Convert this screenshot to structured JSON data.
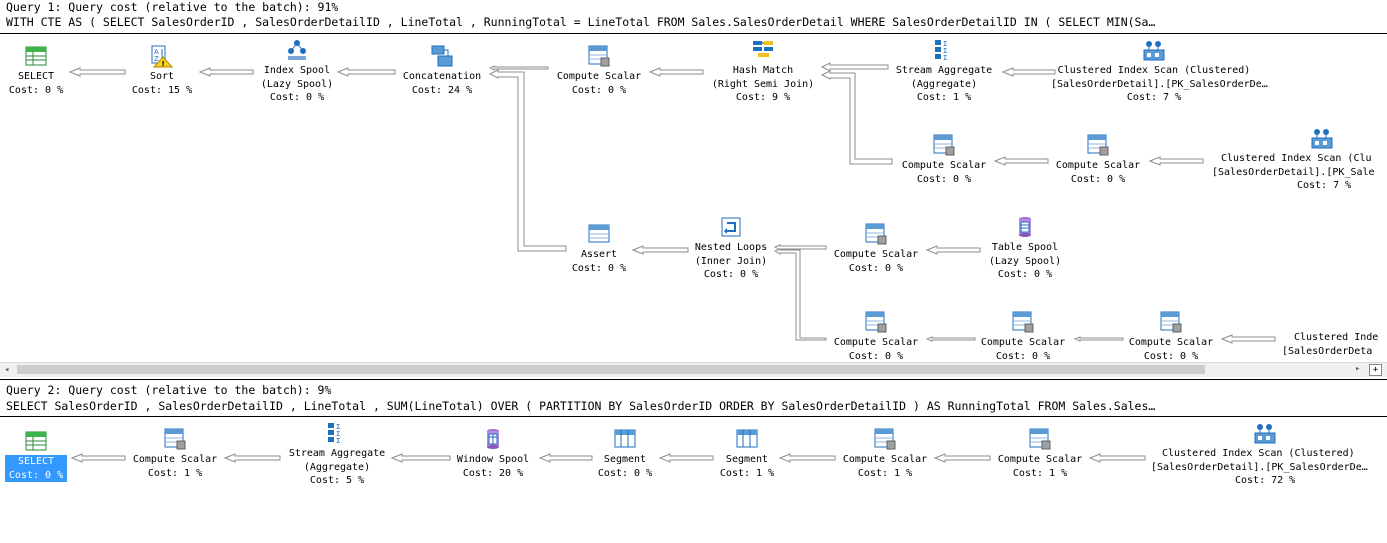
{
  "query1": {
    "header": "Query 1: Query cost (relative to the batch): 91%",
    "sql": "WITH CTE AS ( SELECT SalesOrderID , SalesOrderDetailID , LineTotal , RunningTotal = LineTotal FROM Sales.SalesOrderDetail WHERE SalesOrderDetailID IN ( SELECT MIN(Sa…",
    "nodes": {
      "select": {
        "icon": "select-icon",
        "l1": "SELECT",
        "l2": "Cost: 0 %"
      },
      "sort": {
        "icon": "sort-warning-icon",
        "l1": "Sort",
        "l2": "Cost: 15 %"
      },
      "index_spool": {
        "icon": "index-spool-icon",
        "l1": "Index Spool",
        "l2": "(Lazy Spool)",
        "l3": "Cost: 0 %"
      },
      "concatenation": {
        "icon": "concatenation-icon",
        "l1": "Concatenation",
        "l2": "Cost: 24 %"
      },
      "compute_scalar_a": {
        "icon": "compute-scalar-icon",
        "l1": "Compute Scalar",
        "l2": "Cost: 0 %"
      },
      "hash_match": {
        "icon": "hash-match-icon",
        "l1": "Hash Match",
        "l2": "(Right Semi Join)",
        "l3": "Cost: 9 %"
      },
      "stream_aggregate": {
        "icon": "stream-aggregate-icon",
        "l1": "Stream Aggregate",
        "l2": "(Aggregate)",
        "l3": "Cost: 1 %"
      },
      "ci_scan_a": {
        "icon": "clustered-index-scan-icon",
        "l1": "Clustered Index Scan (Clustered)",
        "l2": "[SalesOrderDetail].[PK_SalesOrderDe…",
        "l3": "Cost: 7 %"
      },
      "compute_scalar_b": {
        "icon": "compute-scalar-icon",
        "l1": "Compute Scalar",
        "l2": "Cost: 0 %"
      },
      "compute_scalar_c": {
        "icon": "compute-scalar-icon",
        "l1": "Compute Scalar",
        "l2": "Cost: 0 %"
      },
      "ci_scan_b": {
        "icon": "clustered-index-scan-icon",
        "l1": "Clustered Index Scan (Clu",
        "l2": "[SalesOrderDetail].[PK_Sale",
        "l3": "Cost: 7 %"
      },
      "assert": {
        "icon": "assert-icon",
        "l1": "Assert",
        "l2": "Cost: 0 %"
      },
      "nested_loops": {
        "icon": "nested-loops-icon",
        "l1": "Nested Loops",
        "l2": "(Inner Join)",
        "l3": "Cost: 0 %"
      },
      "compute_scalar_d": {
        "icon": "compute-scalar-icon",
        "l1": "Compute Scalar",
        "l2": "Cost: 0 %"
      },
      "table_spool": {
        "icon": "table-spool-icon",
        "l1": "Table Spool",
        "l2": "(Lazy Spool)",
        "l3": "Cost: 0 %"
      },
      "compute_scalar_e": {
        "icon": "compute-scalar-icon",
        "l1": "Compute Scalar",
        "l2": "Cost: 0 %"
      },
      "compute_scalar_f": {
        "icon": "compute-scalar-icon",
        "l1": "Compute Scalar",
        "l2": "Cost: 0 %"
      },
      "compute_scalar_g": {
        "icon": "compute-scalar-icon",
        "l1": "Compute Scalar",
        "l2": "Cost: 0 %"
      },
      "ci_scan_c": {
        "icon": "clustered-index-scan-icon",
        "l1": "Clustered Inde",
        "l2": "[SalesOrderDeta"
      }
    }
  },
  "query2": {
    "header": "Query 2: Query cost (relative to the batch): 9%",
    "sql": "SELECT SalesOrderID , SalesOrderDetailID , LineTotal , SUM(LineTotal) OVER ( PARTITION BY SalesOrderID ORDER BY SalesOrderDetailID ) AS RunningTotal FROM Sales.Sales…",
    "nodes": {
      "select": {
        "icon": "select-icon",
        "l1": "SELECT",
        "l2": "Cost: 0 %"
      },
      "compute_scalar_a": {
        "icon": "compute-scalar-icon",
        "l1": "Compute Scalar",
        "l2": "Cost: 1 %"
      },
      "stream_aggregate": {
        "icon": "stream-aggregate-icon",
        "l1": "Stream Aggregate",
        "l2": "(Aggregate)",
        "l3": "Cost: 5 %"
      },
      "window_spool": {
        "icon": "window-spool-icon",
        "l1": "Window Spool",
        "l2": "Cost: 20 %"
      },
      "segment_a": {
        "icon": "segment-icon",
        "l1": "Segment",
        "l2": "Cost: 0 %"
      },
      "segment_b": {
        "icon": "segment-icon",
        "l1": "Segment",
        "l2": "Cost: 1 %"
      },
      "compute_scalar_b": {
        "icon": "compute-scalar-icon",
        "l1": "Compute Scalar",
        "l2": "Cost: 1 %"
      },
      "compute_scalar_c": {
        "icon": "compute-scalar-icon",
        "l1": "Compute Scalar",
        "l2": "Cost: 1 %"
      },
      "ci_scan": {
        "icon": "clustered-index-scan-icon",
        "l1": "Clustered Index Scan (Clustered)",
        "l2": "[SalesOrderDetail].[PK_SalesOrderDe…",
        "l3": "Cost: 72 %"
      }
    }
  },
  "scrollbar": {
    "left_arrow": "◂",
    "right_arrow": "▸",
    "expand": "+"
  },
  "colors": {
    "selection": "#3399ff",
    "edge": "#8c8c8c",
    "icon_blue": "#1f6fc0"
  }
}
